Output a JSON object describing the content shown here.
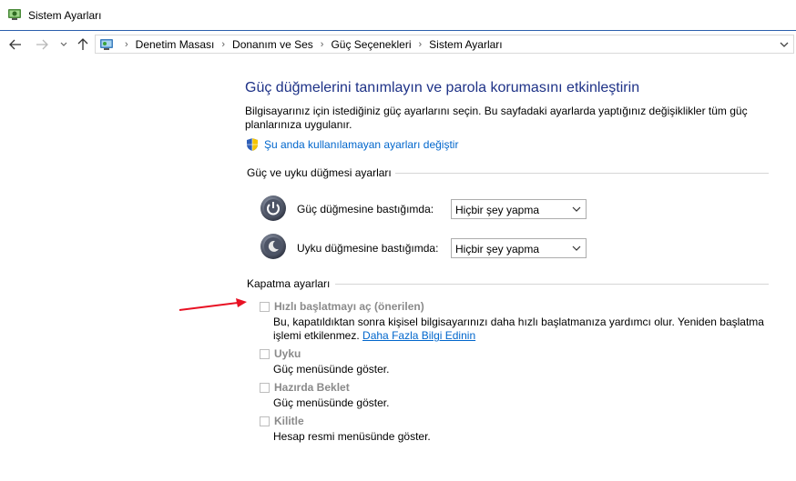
{
  "window": {
    "title": "Sistem Ayarları"
  },
  "nav": {
    "breadcrumbs": [
      "Denetim Masası",
      "Donanım ve Ses",
      "Güç Seçenekleri",
      "Sistem Ayarları"
    ]
  },
  "main": {
    "title": "Güç düğmelerini tanımlayın ve parola korumasını etkinleştirin",
    "description": "Bilgisayarınız için istediğiniz güç ayarlarını seçin. Bu sayfadaki ayarlarda yaptığınız değişiklikler tüm güç planlarınıza uygulanır.",
    "change_link": "Şu anda kullanılamayan ayarları değiştir"
  },
  "power_section": {
    "heading": "Güç ve uyku düğmesi ayarları",
    "power_button": {
      "label": "Güç düğmesine bastığımda:",
      "value": "Hiçbir şey yapma"
    },
    "sleep_button": {
      "label": "Uyku düğmesine bastığımda:",
      "value": "Hiçbir şey yapma"
    }
  },
  "shutdown_section": {
    "heading": "Kapatma ayarları",
    "fast_startup": {
      "label": "Hızlı başlatmayı aç (önerilen)",
      "desc": "Bu, kapatıldıktan sonra kişisel bilgisayarınızı daha hızlı başlatmanıza yardımcı olur. Yeniden başlatma işlemi etkilenmez.",
      "link": "Daha Fazla Bilgi Edinin"
    },
    "sleep": {
      "label": "Uyku",
      "desc": "Güç menüsünde göster."
    },
    "hibernate": {
      "label": "Hazırda Beklet",
      "desc": "Güç menüsünde göster."
    },
    "lock": {
      "label": "Kilitle",
      "desc": "Hesap resmi menüsünde göster."
    }
  },
  "colors": {
    "title_blue": "#1e3287",
    "link_blue": "#0066cc",
    "arrow_red": "#e81123"
  }
}
